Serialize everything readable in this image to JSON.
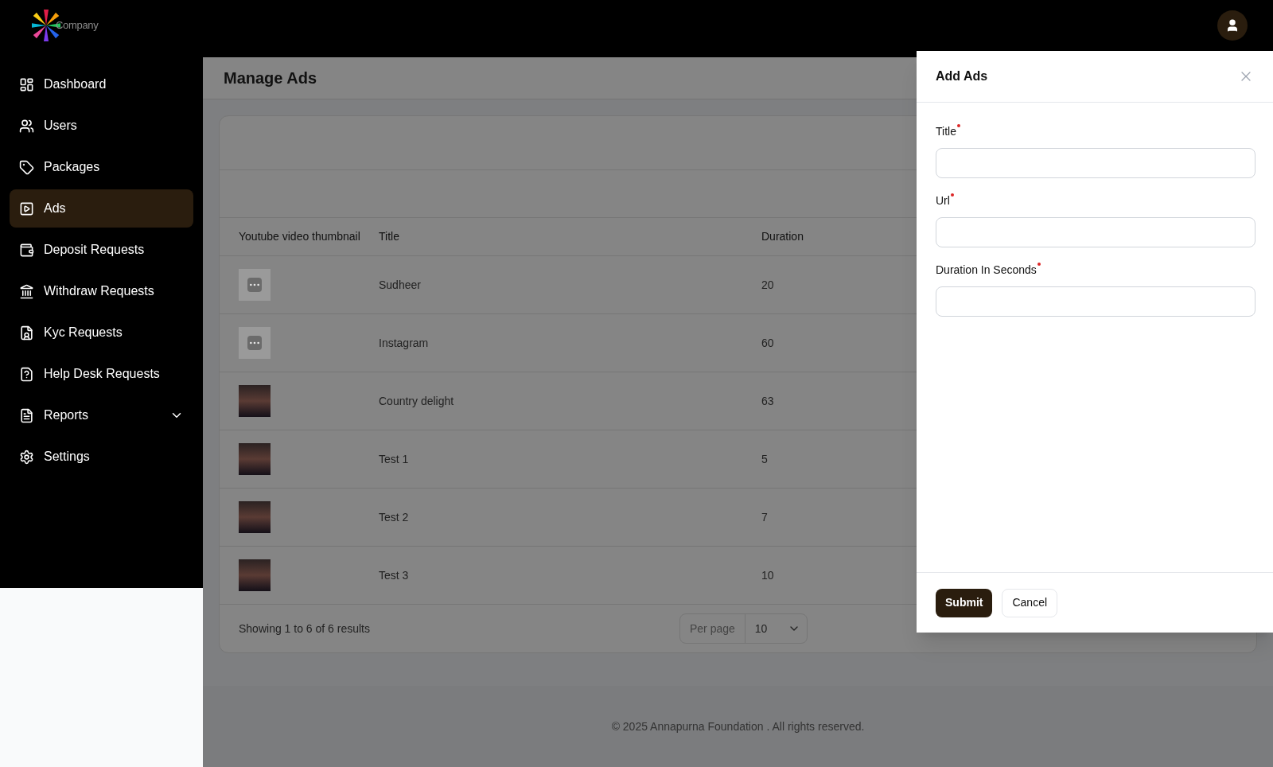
{
  "logo": {
    "text": "Company"
  },
  "sidebar": {
    "items": [
      {
        "label": "Dashboard",
        "selected": false
      },
      {
        "label": "Users",
        "selected": false
      },
      {
        "label": "Packages",
        "selected": false
      },
      {
        "label": "Ads",
        "selected": true
      },
      {
        "label": "Deposit Requests",
        "selected": false
      },
      {
        "label": "Withdraw Requests",
        "selected": false
      },
      {
        "label": "Kyc Requests",
        "selected": false
      },
      {
        "label": "Help Desk Requests",
        "selected": false
      },
      {
        "label": "Reports",
        "selected": false,
        "expanded": false
      },
      {
        "label": "Settings",
        "selected": false
      }
    ]
  },
  "page": {
    "title": "Manage Ads"
  },
  "table": {
    "columns": [
      "Youtube video thumbnail",
      "Title",
      "Duration"
    ],
    "rows": [
      {
        "kind": "placeholder",
        "title": "Sudheer",
        "duration": "20"
      },
      {
        "kind": "placeholder",
        "title": "Instagram",
        "duration": "60"
      },
      {
        "kind": "photo",
        "title": "Country delight",
        "duration": "63"
      },
      {
        "kind": "photo",
        "title": "Test 1",
        "duration": "5"
      },
      {
        "kind": "photo",
        "title": "Test 2",
        "duration": "7"
      },
      {
        "kind": "photo",
        "title": "Test 3",
        "duration": "10"
      }
    ],
    "summary": "Showing 1 to 6 of 6 results",
    "per_page_label": "Per page",
    "per_page_value": "10"
  },
  "footer": "© 2025 Annapurna Foundation . All rights reserved.",
  "drawer": {
    "title": "Add Ads",
    "fields": [
      {
        "label": "Title",
        "required": true
      },
      {
        "label": "Url",
        "required": true
      },
      {
        "label": "Duration In Seconds",
        "required": true
      }
    ],
    "buttons": [
      {
        "label": "Submit",
        "kind": "primary"
      },
      {
        "label": "Cancel",
        "kind": "secondary"
      }
    ]
  }
}
